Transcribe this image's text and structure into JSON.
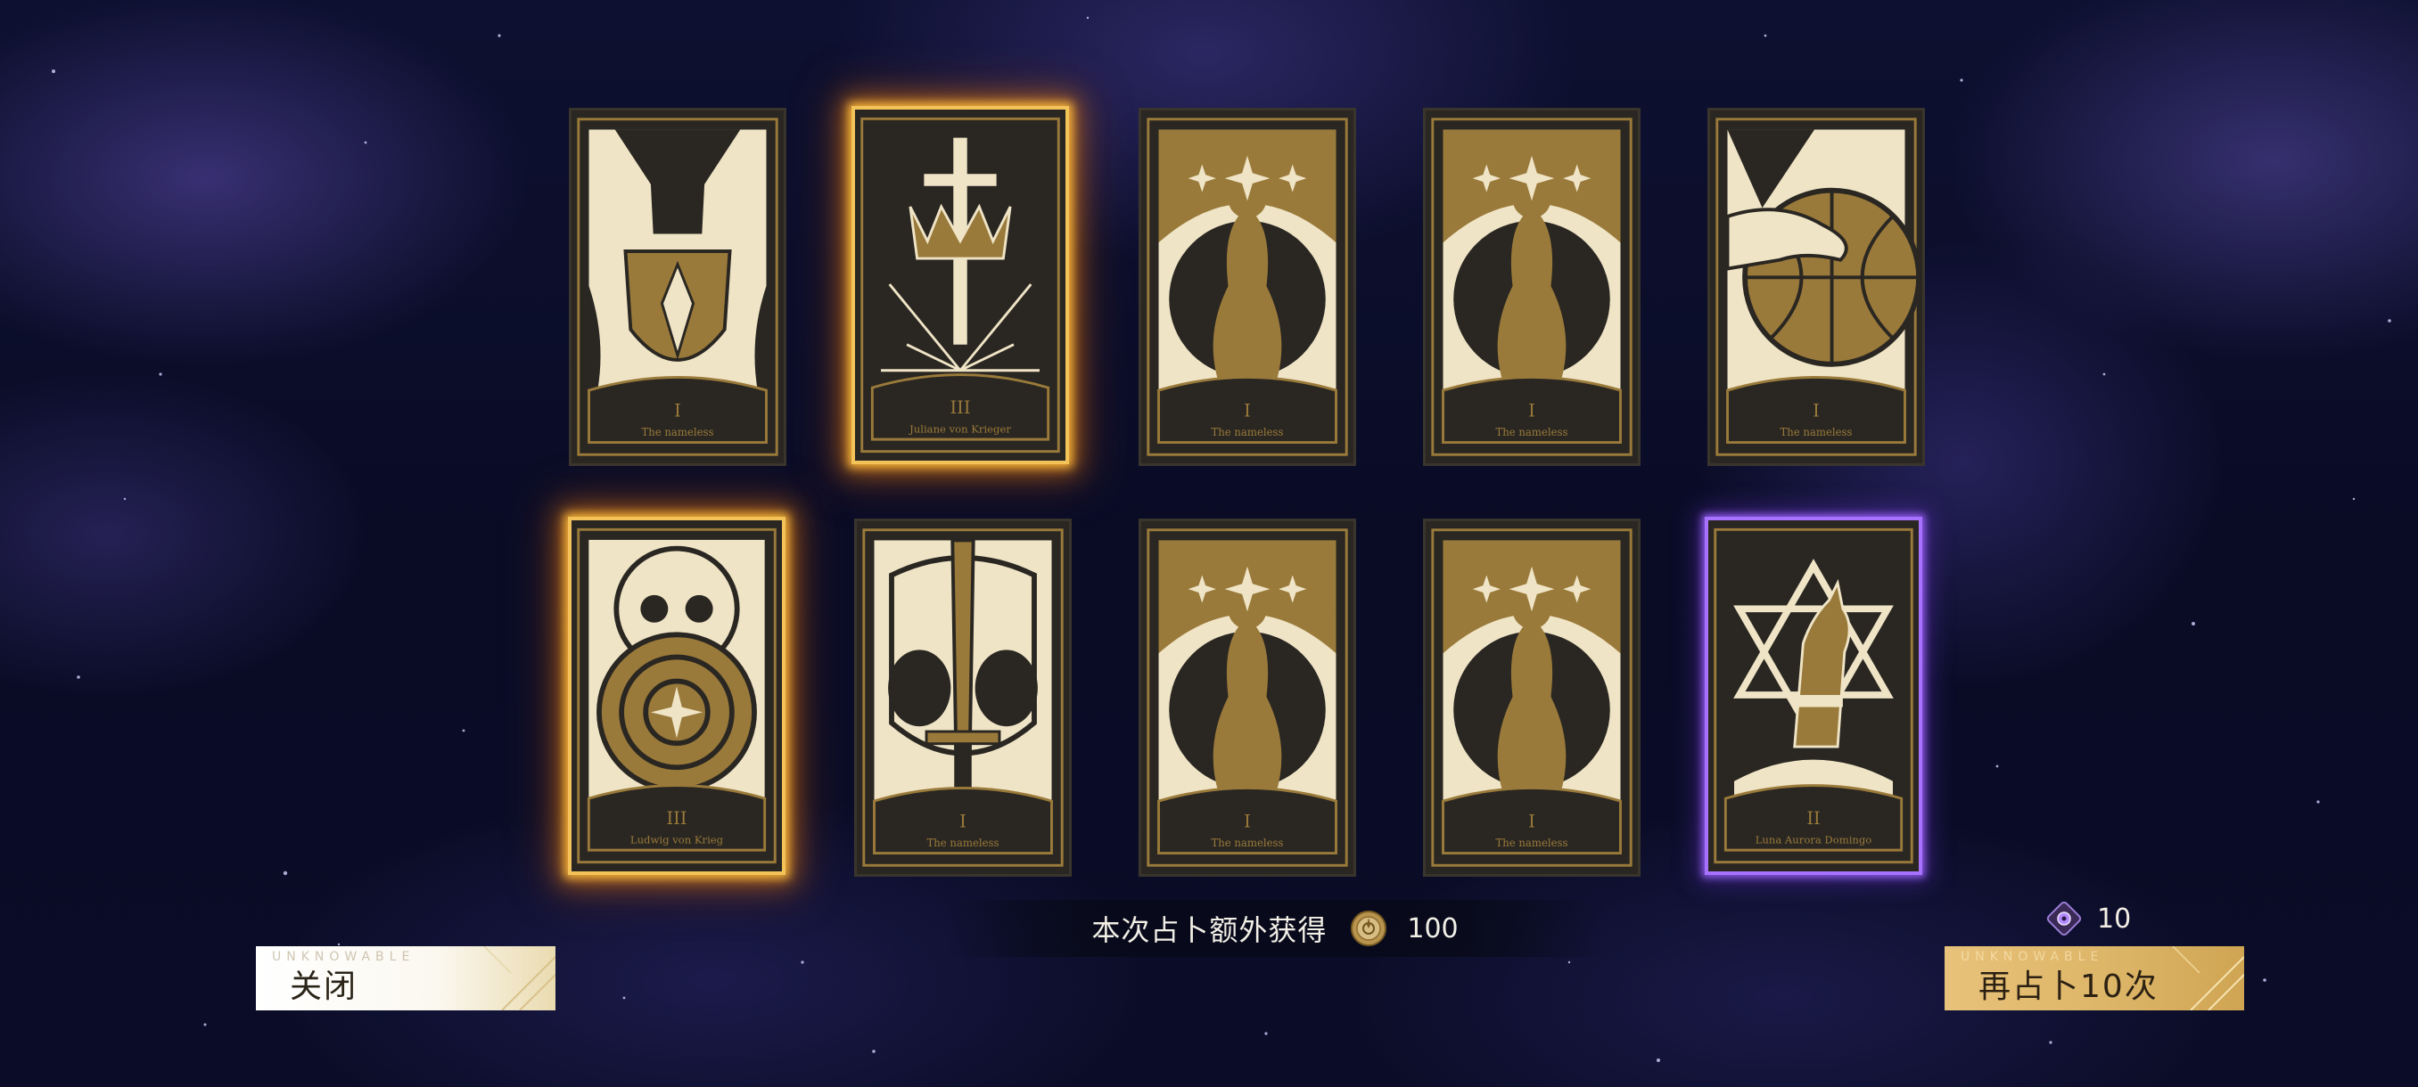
{
  "screen": "tarot-draw-results",
  "cards": [
    {
      "id": "r1c1",
      "numeral": "I",
      "name": "The nameless",
      "art": "shield-mask",
      "frame": "normal"
    },
    {
      "id": "r1c2",
      "numeral": "III",
      "name": "Juliane von Krieger",
      "art": "crowned-sword",
      "frame": "gold-glow"
    },
    {
      "id": "r1c3",
      "numeral": "I",
      "name": "The nameless",
      "art": "star-goddess",
      "frame": "normal"
    },
    {
      "id": "r1c4",
      "numeral": "I",
      "name": "The nameless",
      "art": "star-goddess",
      "frame": "normal"
    },
    {
      "id": "r1c5",
      "numeral": "I",
      "name": "The nameless",
      "art": "hand-globe",
      "frame": "normal"
    },
    {
      "id": "r2c1",
      "numeral": "III",
      "name": "Ludwig von Krieg",
      "art": "serpent-skull",
      "frame": "gold-glow"
    },
    {
      "id": "r2c2",
      "numeral": "I",
      "name": "The nameless",
      "art": "sword-mask",
      "frame": "normal"
    },
    {
      "id": "r2c3",
      "numeral": "I",
      "name": "The nameless",
      "art": "star-goddess",
      "frame": "normal"
    },
    {
      "id": "r2c4",
      "numeral": "I",
      "name": "The nameless",
      "art": "star-goddess",
      "frame": "normal"
    },
    {
      "id": "r2c5",
      "numeral": "II",
      "name": "Luna Aurora Domingo",
      "art": "hexagram-cat",
      "frame": "purple-glow"
    }
  ],
  "reward": {
    "label": "本次占卜额外获得",
    "icon": "coin-icon",
    "value": "100"
  },
  "cost": {
    "icon": "divination-ticket-icon",
    "value": "10"
  },
  "buttons": {
    "close": {
      "watermark": "UNKNOWABLE",
      "label": "关闭"
    },
    "draw_again": {
      "watermark": "UNKNOWABLE",
      "label": "再占卜10次"
    }
  },
  "colors": {
    "card_gold": "#9a7a3a",
    "card_cream": "#efe4c6",
    "card_dark": "#2a2722",
    "glow_gold": "#f3c35a",
    "glow_purple": "#a772ff",
    "button_light": "#fbf8f0",
    "button_gold": "#dcb466"
  }
}
